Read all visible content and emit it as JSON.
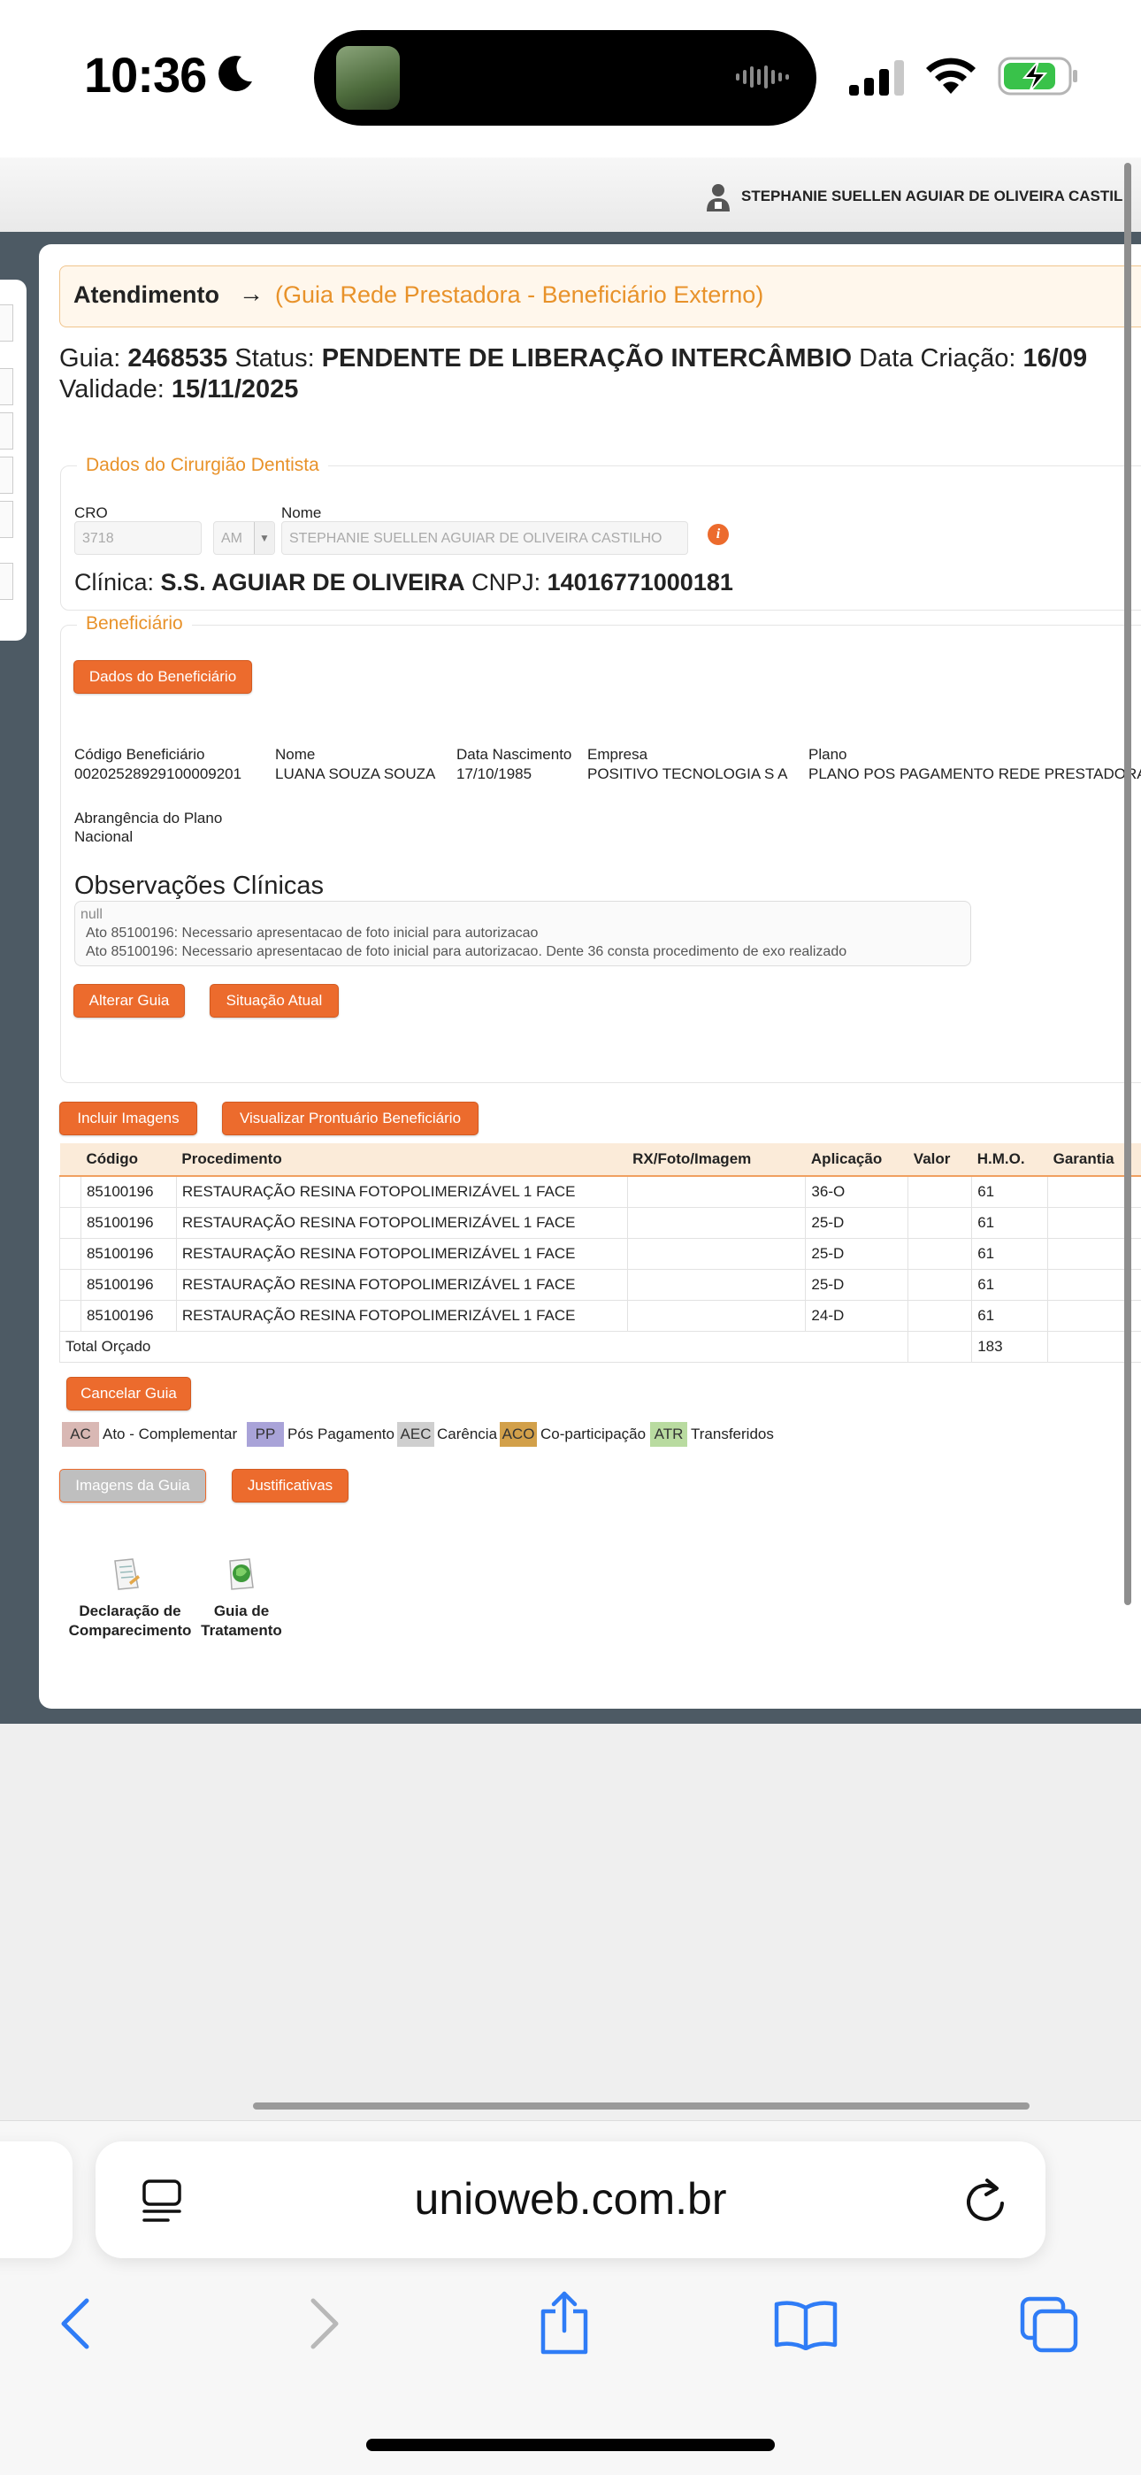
{
  "status_bar": {
    "time": "10:36"
  },
  "app": {
    "user_name": "STEPHANIE SUELLEN AGUIAR DE OLIVEIRA CASTIL",
    "header": {
      "title": "Atendimento",
      "arrow": "→",
      "subtitle": "(Guia Rede Prestadora - Beneficiário Externo)"
    },
    "guia": {
      "guia_label": "Guia:",
      "guia_value": "2468535",
      "status_label": "Status:",
      "status_value": "PENDENTE DE LIBERAÇÃO INTERCÂMBIO",
      "data_label": "Data Criação:",
      "data_value": "16/09",
      "validade_label": "Validade:",
      "validade_value": "15/11/2025"
    },
    "dentista": {
      "legend": "Dados do Cirurgião Dentista",
      "cro_label": "CRO",
      "cro_value": "3718",
      "uf_value": "AM",
      "nome_label": "Nome",
      "nome_value": "STEPHANIE SUELLEN AGUIAR DE OLIVEIRA CASTILHO",
      "clinica_label": "Clínica:",
      "clinica_value": "S.S. AGUIAR DE OLIVEIRA",
      "cnpj_label": "CNPJ:",
      "cnpj_value": "14016771000181"
    },
    "beneficiario": {
      "legend": "Beneficiário",
      "btn_dados": "Dados do Beneficiário",
      "codigo_label": "Código Beneficiário",
      "codigo_value": "00202528929100009201",
      "nome_label": "Nome",
      "nome_value": "LUANA SOUZA SOUZA",
      "nasc_label": "Data Nascimento",
      "nasc_value": "17/10/1985",
      "empresa_label": "Empresa",
      "empresa_value": "POSITIVO TECNOLOGIA S A",
      "plano_label": "Plano",
      "plano_value": "PLANO POS PAGAMENTO REDE PRESTADORA",
      "abrang_label": "Abrangência do Plano",
      "abrang_value": "Nacional",
      "obs_title": "Observações Clínicas",
      "obs_lines": [
        "null",
        "Ato 85100196: Necessario apresentacao de foto inicial para autorizacao",
        "Ato 85100196: Necessario apresentacao de foto inicial para autorizacao. Dente 36 consta procedimento de exo realizado"
      ],
      "btn_alterar": "Alterar Guia",
      "btn_situacao": "Situação Atual"
    },
    "buttons": {
      "incluir": "Incluir Imagens",
      "visualizar": "Visualizar Prontuário Beneficiário",
      "cancelar": "Cancelar Guia",
      "imagens_guia": "Imagens da Guia",
      "justificativas": "Justificativas"
    },
    "table": {
      "headers": [
        "",
        "Código",
        "Procedimento",
        "RX/Foto/Imagem",
        "Aplicação",
        "Valor",
        "H.M.O.",
        "Garantia"
      ],
      "rows": [
        [
          "",
          "85100196",
          "RESTAURAÇÃO RESINA FOTOPOLIMERIZÁVEL 1 FACE",
          "",
          "36-O",
          "",
          "61",
          ""
        ],
        [
          "",
          "85100196",
          "RESTAURAÇÃO RESINA FOTOPOLIMERIZÁVEL 1 FACE",
          "",
          "25-D",
          "",
          "61",
          ""
        ],
        [
          "",
          "85100196",
          "RESTAURAÇÃO RESINA FOTOPOLIMERIZÁVEL 1 FACE",
          "",
          "25-D",
          "",
          "61",
          ""
        ],
        [
          "",
          "85100196",
          "RESTAURAÇÃO RESINA FOTOPOLIMERIZÁVEL 1 FACE",
          "",
          "25-D",
          "",
          "61",
          ""
        ],
        [
          "",
          "85100196",
          "RESTAURAÇÃO RESINA FOTOPOLIMERIZÁVEL 1 FACE",
          "",
          "24-D",
          "",
          "61",
          ""
        ]
      ],
      "total_label": "Total Orçado",
      "total_hmo": "183"
    },
    "legend_items": [
      {
        "code": "AC",
        "text": "Ato - Complementar",
        "color": "#d9b8b4"
      },
      {
        "code": "PP",
        "text": "Pós Pagamento",
        "color": "#a9a3d8"
      },
      {
        "code": "AEC",
        "text": "Carência",
        "color": "#cfcfcf"
      },
      {
        "code": "ACO",
        "text": "Co-participação",
        "color": "#d2a04a"
      },
      {
        "code": "ATR",
        "text": "Transferidos",
        "color": "#b9dba0"
      }
    ],
    "docs": [
      {
        "line1": "Declaração de",
        "line2": "Comparecimento",
        "icon": "document-icon"
      },
      {
        "line1": "Guia de",
        "line2": "Tratamento",
        "icon": "guide-icon"
      }
    ]
  },
  "browser": {
    "url": "unioweb.com.br"
  }
}
